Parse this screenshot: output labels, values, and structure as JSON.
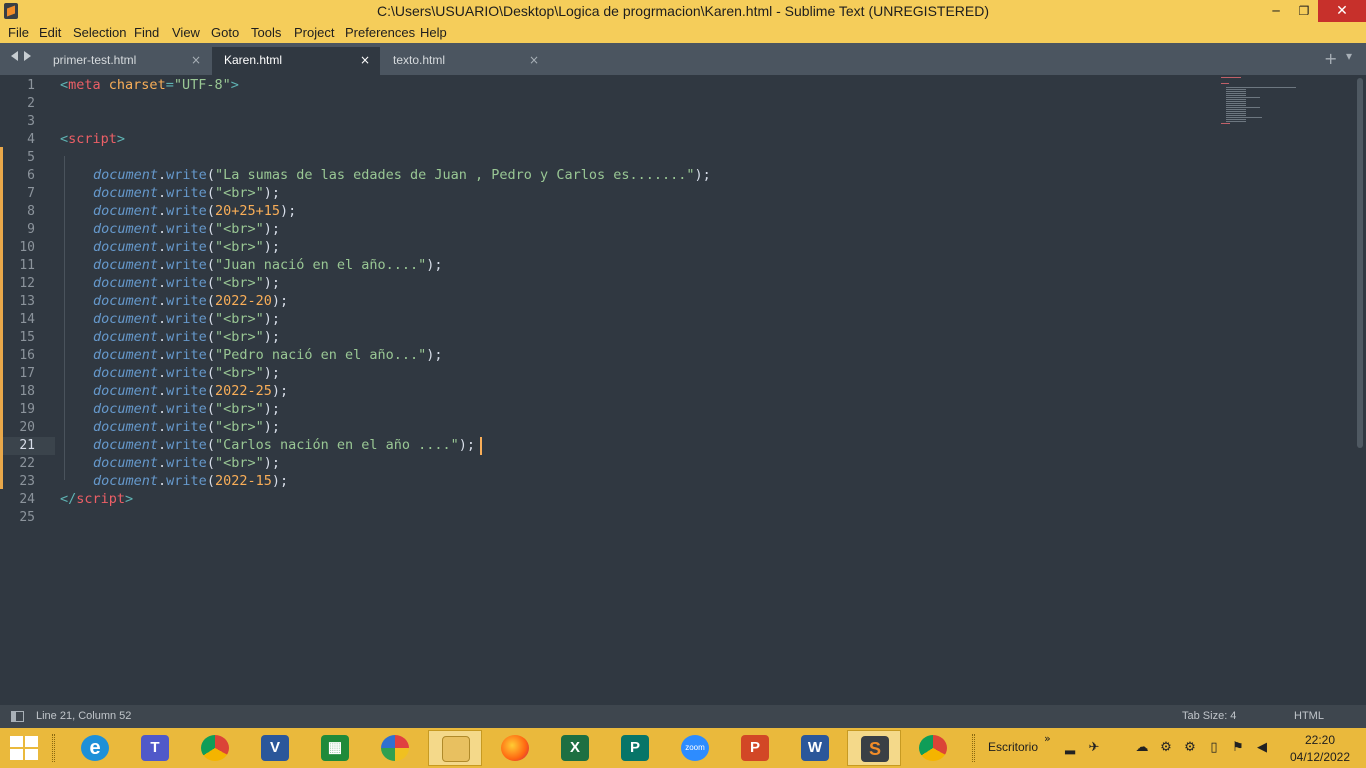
{
  "window": {
    "title": "C:\\Users\\USUARIO\\Desktop\\Logica de progrmacion\\Karen.html - Sublime Text (UNREGISTERED)",
    "min_glyph": "─",
    "max_glyph": "❐",
    "close_glyph": "✕"
  },
  "menu": [
    "File",
    "Edit",
    "Selection",
    "Find",
    "View",
    "Goto",
    "Tools",
    "Project",
    "Preferences",
    "Help"
  ],
  "tabs": [
    {
      "label": "primer-test.html",
      "close": "×",
      "active": false
    },
    {
      "label": "Karen.html",
      "close": "×",
      "active": true
    },
    {
      "label": "texto.html",
      "close": "×",
      "active": false
    }
  ],
  "tab_actions": {
    "new_tab": "+",
    "dropdown": "▾"
  },
  "editor": {
    "active_line": 21,
    "line_numbers": [
      "1",
      "2",
      "3",
      "4",
      "5",
      "6",
      "7",
      "8",
      "9",
      "10",
      "11",
      "12",
      "13",
      "14",
      "15",
      "16",
      "17",
      "18",
      "19",
      "20",
      "21",
      "22",
      "23",
      "24",
      "25"
    ],
    "code": {
      "l1_tag_open": "<",
      "l1_tag": "meta",
      "l1_attr": "charset",
      "l1_eq": "=",
      "l1_val": "\"UTF-8\"",
      "l1_close": ">",
      "l4_open": "<",
      "l4_tag": "script",
      "l4_close": ">",
      "obj": "document",
      "dot": ".",
      "fn": "write",
      "br": "\"<br>\"",
      "s6": "\"La sumas de las edades de Juan , Pedro y Carlos es.......\"",
      "n8": "20+25+15",
      "s11": "\"Juan nació en el año....\"",
      "n13": "2022-20",
      "s16": "\"Pedro nació en el año...\"",
      "n18": "2022-25",
      "s21": "\"Carlos nación en el año ....\"",
      "n23": "2022-15",
      "paren_open": "(",
      "paren_close": ");",
      "l24_open": "</",
      "l24_tag": "script",
      "l24_close": ">"
    }
  },
  "status": {
    "position": "Line 21, Column 52",
    "tab_size": "Tab Size: 4",
    "syntax": "HTML"
  },
  "taskbar": {
    "apps": [
      "start",
      "internet-explorer",
      "teams",
      "chrome",
      "visio",
      "project-green",
      "picasa",
      "file-explorer",
      "firefox",
      "excel",
      "publisher",
      "zoom",
      "powerpoint",
      "word",
      "sublime-text",
      "chrome-user"
    ],
    "zoom_label": "zoom",
    "tray_label": "Escritorio",
    "tray_chevron": "»",
    "time": "22:20",
    "date": "04/12/2022"
  },
  "colors": {
    "titlebar": "#f5cd5a",
    "editor_bg": "#303841",
    "tag": "#ec5f66",
    "string": "#99c794",
    "number": "#f9ae58",
    "function": "#6699cc"
  }
}
